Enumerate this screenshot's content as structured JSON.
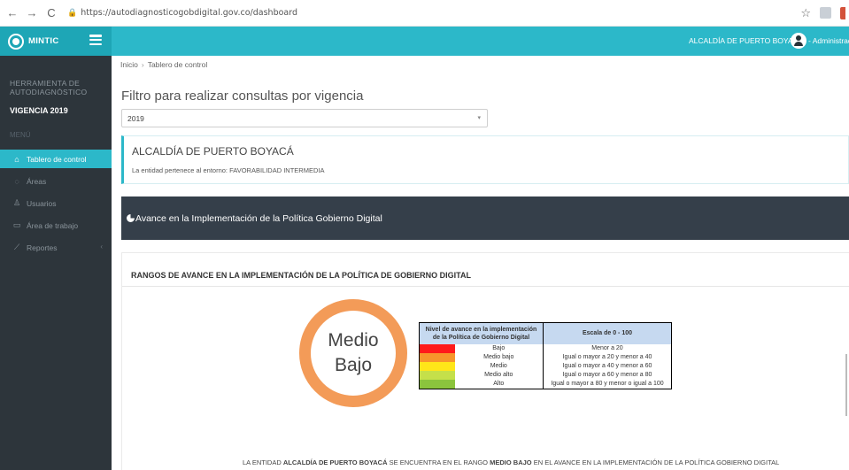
{
  "browser": {
    "url": "https://autodiagnosticogobdigital.gov.co/dashboard"
  },
  "header": {
    "brand": "MINTIC",
    "entity": "ALCALDÍA DE PUERTO BOYACÁ",
    "user": "- Administrador"
  },
  "sidebar": {
    "tool_line1": "HERRAMIENTA DE",
    "tool_line2": "AUTODIAGNÓSTICO",
    "vigencia": "VIGENCIA 2019",
    "menu_label": "MENÚ",
    "items": [
      {
        "label": "Tablero de control",
        "icon": "home-icon"
      },
      {
        "label": "Áreas",
        "icon": "pin-icon"
      },
      {
        "label": "Usuarios",
        "icon": "users-icon"
      },
      {
        "label": "Área de trabajo",
        "icon": "desk-icon"
      },
      {
        "label": "Reportes",
        "icon": "chart-icon"
      }
    ]
  },
  "breadcrumb": {
    "home": "Inicio",
    "current": "Tablero de control"
  },
  "filter": {
    "title": "Filtro para realizar consultas por vigencia",
    "selected": "2019"
  },
  "entity_card": {
    "title": "ALCALDÍA DE PUERTO BOYACÁ",
    "subtitle": "La entidad pertenece al entorno: FAVORABILIDAD INTERMEDIA"
  },
  "section": {
    "title": "Avance en la Implementación de la Política Gobierno Digital"
  },
  "rangos": {
    "title": "RANGOS DE AVANCE EN LA IMPLEMENTACIÓN DE LA POLÍTICA DE GOBIERNO DIGITAL",
    "ring_line1": "Medio",
    "ring_line2": "Bajo",
    "ring_color": "#f39b58",
    "table_header_left": "Nivel de avance en la implementación de la Política de Gobierno Digital",
    "table_header_right": "Escala de 0 - 100",
    "rows": [
      {
        "label": "Bajo",
        "range": "Menor a 20",
        "color": "#ff1a1a"
      },
      {
        "label": "Medio bajo",
        "range": "Igual o mayor a 20 y menor a 40",
        "color": "#f7962b"
      },
      {
        "label": "Medio",
        "range": "Igual o mayor a 40 y menor a 60",
        "color": "#ffe619"
      },
      {
        "label": "Medio alto",
        "range": "Igual o mayor a 60 y menor a 80",
        "color": "#c5e04a"
      },
      {
        "label": "Alto",
        "range": "Igual o mayor a 80 y menor o igual a 100",
        "color": "#8bc43d"
      }
    ],
    "footnote_1": "LA ENTIDAD ",
    "footnote_entity": "ALCALDÍA DE PUERTO BOYACÁ",
    "footnote_2": " SE ENCUENTRA EN EL RANGO ",
    "footnote_level": "MEDIO BAJO",
    "footnote_3": " EN EL AVANCE EN LA IMPLEMENTACIÓN DE LA POLÍTICA GOBIERNO DIGITAL"
  }
}
